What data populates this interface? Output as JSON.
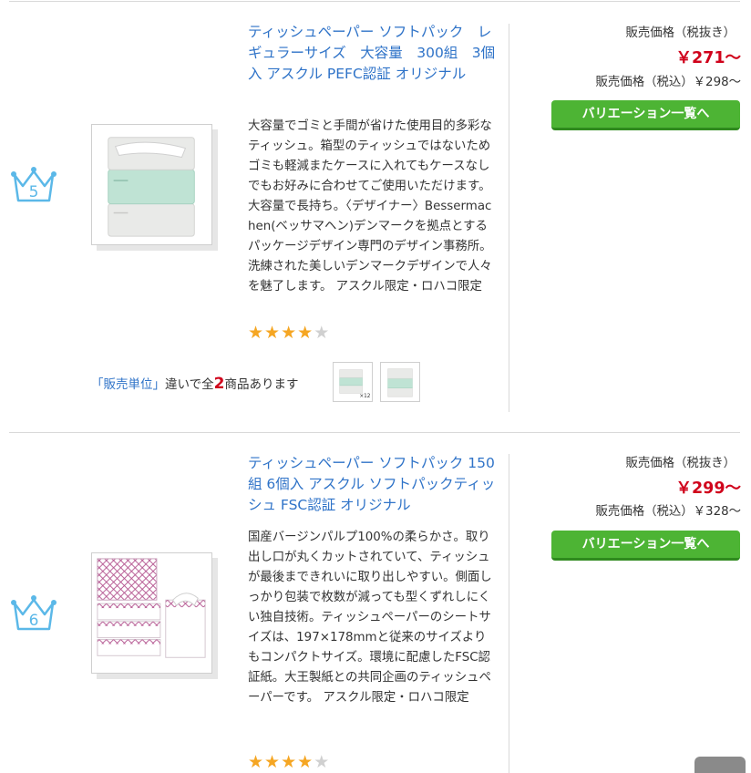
{
  "products": [
    {
      "rank": "5",
      "title": "ティッシュペーパー ソフトパック　レギュラーサイズ　大容量　300組　3個入 アスクル PEFC認証 オリジナル",
      "description": "大容量でゴミと手間が省けた使用目的多彩なティッシュ。箱型のティッシュではないためゴミも軽減またケースに入れてもケースなしでもお好みに合わせてご使用いただけます。大容量で長持ち。〈デザイナー〉Bessermachen(ベッサマヘン)デンマークを拠点とするパッケージデザイン専門のデザイン事務所。洗練された美しいデンマークデザインで人々を魅了します。 アスクル限定・ロハコ限定",
      "rating": 4,
      "variant_unit": "「販売単位」",
      "variant_mid": "違いで全",
      "variant_count": "2",
      "variant_suffix": "商品あります",
      "thumb_badge": "×12",
      "price_label": "販売価格（税抜き）",
      "price": "￥271～",
      "price_tax": "販売価格（税込）￥298～",
      "button": "バリエーション一覧へ"
    },
    {
      "rank": "6",
      "title": "ティッシュペーパー ソフトパック 150組 6個入 アスクル ソフトパックティッシュ FSC認証 オリジナル",
      "description": "国産バージンパルプ100%の柔らかさ。取り出し口が丸くカットされていて、ティッシュが最後まできれいに取り出しやすい。側面しっかり包装で枚数が減っても型くずれしにくい独自技術。ティッシュペーパーのシートサイズは、197×178mmと従来のサイズよりもコンパクトサイズ。環境に配慮したFSC認証紙。大王製紙との共同企画のティッシュペーパーです。 アスクル限定・ロハコ限定",
      "rating": 4,
      "price_label": "販売価格（税抜き）",
      "price": "￥299～",
      "price_tax": "販売価格（税込）￥328～",
      "button": "バリエーション一覧へ"
    }
  ],
  "icons": {
    "crown": "crown-icon",
    "star": "star-icon",
    "scroll_top": "scroll-top-button"
  },
  "colors": {
    "link": "#2f73c8",
    "price": "#d0021b",
    "button": "#4db434",
    "crown": "#5bb8e8",
    "star": "#f5a623"
  }
}
